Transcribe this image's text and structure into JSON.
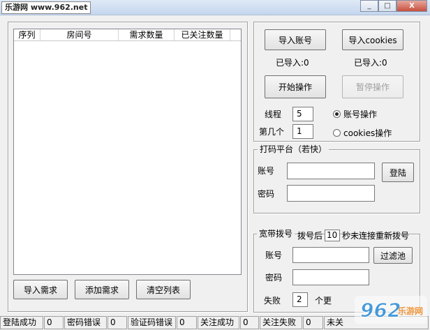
{
  "window": {
    "watermark": "乐游网 www.962.net",
    "controls": [
      "_",
      "□",
      "X"
    ]
  },
  "list": {
    "columns": [
      "序列",
      "房间号",
      "需求数量",
      "已关注数量"
    ],
    "rows": []
  },
  "list_buttons": {
    "import_demand": "导入需求",
    "add_demand": "添加需求",
    "clear_list": "清空列表"
  },
  "account_panel": {
    "import_account": "导入账号",
    "import_cookies": "导入cookies",
    "imported_account": "已导入:0",
    "imported_cookies": "已导入:0",
    "start": "开始操作",
    "pause": "暂停操作",
    "thread_label": "线程",
    "thread_value": "5",
    "nth_label": "第几个",
    "nth_value": "1",
    "mode_account": "账号操作",
    "mode_cookies": "cookies操作"
  },
  "captcha_platform": {
    "title": "打码平台（若快）",
    "account_label": "账号",
    "password_label": "密码",
    "login": "登陆"
  },
  "broadband": {
    "title": "宽带拨号",
    "after_label": "拨号后",
    "seconds_value": "10",
    "reconnect_text": "秒未连接重新拨号",
    "account_label": "账号",
    "password_label": "密码",
    "filter_button": "过滤池",
    "fail_label": "失败",
    "fail_value": "2",
    "fail_suffix": "个更"
  },
  "status": {
    "login_ok": "登陆成功",
    "login_ok_value": "0",
    "pwd_err": "密码错误",
    "pwd_err_value": "0",
    "captcha_err": "验证码错误",
    "captcha_err_value": "0",
    "follow_ok": "关注成功",
    "follow_ok_value": "0",
    "follow_fail": "关注失败",
    "follow_fail_value": "0",
    "not_followed": "未关"
  },
  "logo": {
    "text": "962",
    "sub": "乐游网"
  },
  "colors": {
    "accent": "#2f8fd8",
    "logo_orange": "#f28c28"
  }
}
